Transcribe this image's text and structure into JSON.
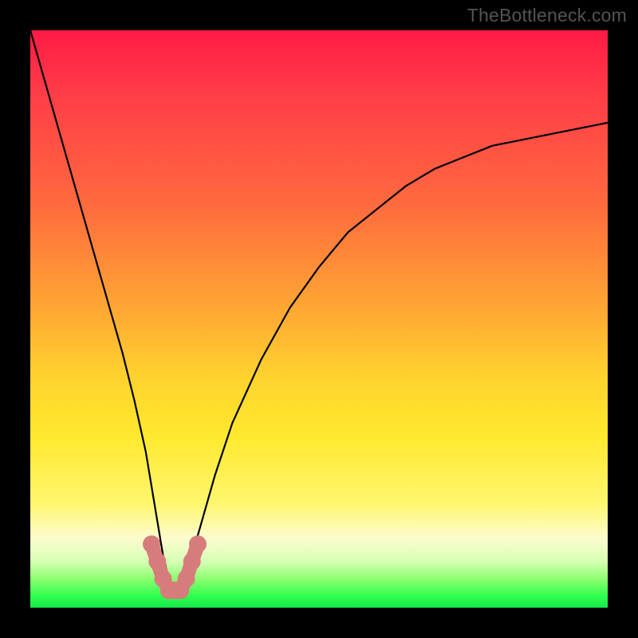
{
  "watermark": "TheBottleneck.com",
  "chart_data": {
    "type": "line",
    "title": "",
    "xlabel": "",
    "ylabel": "",
    "xlim": [
      0,
      100
    ],
    "ylim": [
      0,
      100
    ],
    "grid": false,
    "series": [
      {
        "name": "bottleneck-curve",
        "x": [
          0,
          2,
          4,
          6,
          8,
          10,
          12,
          14,
          16,
          18,
          20,
          22,
          23,
          24,
          25,
          26,
          27,
          28,
          30,
          32,
          35,
          40,
          45,
          50,
          55,
          60,
          65,
          70,
          75,
          80,
          85,
          90,
          95,
          100
        ],
        "values": [
          100,
          93,
          86,
          79,
          72,
          65,
          58,
          51,
          44,
          36,
          27,
          15,
          9,
          5,
          3,
          3,
          5,
          9,
          16,
          23,
          32,
          43,
          52,
          59,
          65,
          69,
          73,
          76,
          78,
          80,
          81,
          82,
          83,
          84
        ]
      }
    ],
    "highlight_valley": {
      "x": [
        21,
        22,
        23,
        24,
        25,
        26,
        27,
        28,
        29
      ],
      "values": [
        11,
        8,
        5,
        3,
        3,
        3,
        5,
        8,
        11
      ]
    },
    "colors": {
      "curve": "#000000",
      "highlight": "#d77c7c",
      "gradient_top": "#ff1a45",
      "gradient_mid": "#ffd22e",
      "gradient_bottom": "#16e84a",
      "frame": "#000000"
    }
  }
}
